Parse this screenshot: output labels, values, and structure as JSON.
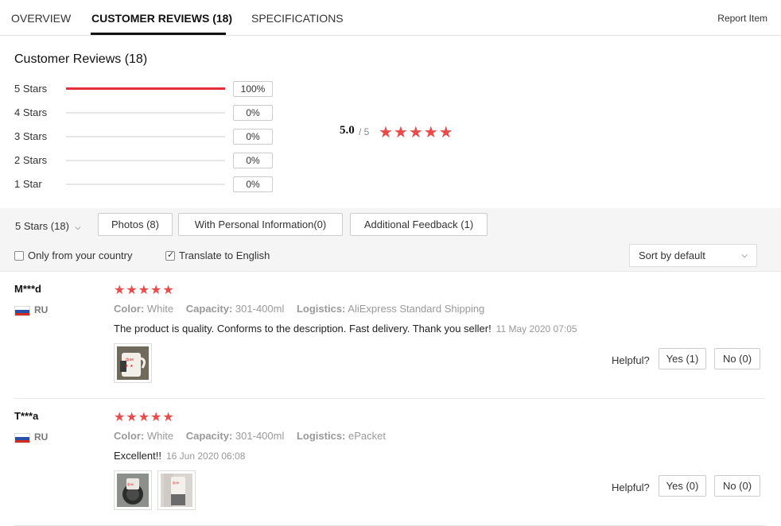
{
  "tabs": [
    {
      "label": "OVERVIEW"
    },
    {
      "label": "CUSTOMER REVIEWS (18)"
    },
    {
      "label": "SPECIFICATIONS"
    }
  ],
  "report_label": "Report Item",
  "summary": {
    "title": "Customer Reviews (18)",
    "rows": [
      {
        "label": "5 Stars",
        "pct": "100%",
        "fill": 1.0
      },
      {
        "label": "4 Stars",
        "pct": "0%",
        "fill": 0
      },
      {
        "label": "3 Stars",
        "pct": "0%",
        "fill": 0
      },
      {
        "label": "2 Stars",
        "pct": "0%",
        "fill": 0
      },
      {
        "label": "1 Star",
        "pct": "0%",
        "fill": 0
      }
    ],
    "average": "5.0",
    "average_of": "/ 5",
    "stars": "★★★★★",
    "star_color": "#e94b4b",
    "bar_color": "#e62e3a"
  },
  "filters": {
    "star_select": "5 Stars (18)",
    "buttons": [
      "Photos (8)",
      "With Personal Information(0)",
      "Additional Feedback (1)"
    ],
    "only_country": "Only from your country",
    "translate": "Translate to English",
    "translate_checked": true,
    "sort": "Sort by default"
  },
  "reviews": [
    {
      "user": "M***d",
      "country": "RU",
      "stars": "★★★★★",
      "color_label": "Color:",
      "color_value": "White",
      "capacity_label": "Capacity:",
      "capacity_value": "301-400ml",
      "logistics_label": "Logistics:",
      "logistics_value": "AliExpress Standard Shipping",
      "text": "The product is quality. Conforms to the description. Fast delivery. Thank you seller!",
      "date": "11 May 2020 07:05",
      "helpful": "Helpful?",
      "yes": "Yes (1)",
      "no": "No (0)"
    },
    {
      "user": "T***a",
      "country": "RU",
      "stars": "★★★★★",
      "color_label": "Color:",
      "color_value": "White",
      "capacity_label": "Capacity:",
      "capacity_value": "301-400ml",
      "logistics_label": "Logistics:",
      "logistics_value": "ePacket",
      "text": "Excellent!!",
      "date": "16 Jun 2020 06:08",
      "helpful": "Helpful?",
      "yes": "Yes (0)",
      "no": "No (0)"
    }
  ]
}
